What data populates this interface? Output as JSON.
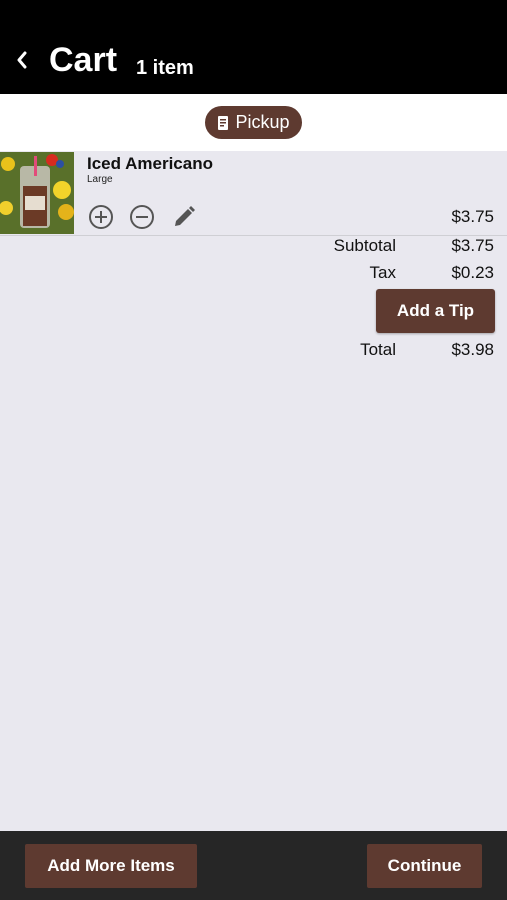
{
  "header": {
    "title": "Cart",
    "item_count": "1 item"
  },
  "mode": {
    "label": "Pickup"
  },
  "cart_items": [
    {
      "name": "Iced Americano",
      "size": "Large",
      "price": "$3.75"
    }
  ],
  "summary": {
    "subtotal_label": "Subtotal",
    "subtotal_value": "$3.75",
    "tax_label": "Tax",
    "tax_value": "$0.23",
    "tip_button": "Add a Tip",
    "total_label": "Total",
    "total_value": "$3.98"
  },
  "footer": {
    "add_more_label": "Add More Items",
    "continue_label": "Continue"
  },
  "colors": {
    "accent": "#5e3a30",
    "header_bg": "#000000",
    "footer_bg": "#262626",
    "page_bg": "#e9e8ef"
  }
}
